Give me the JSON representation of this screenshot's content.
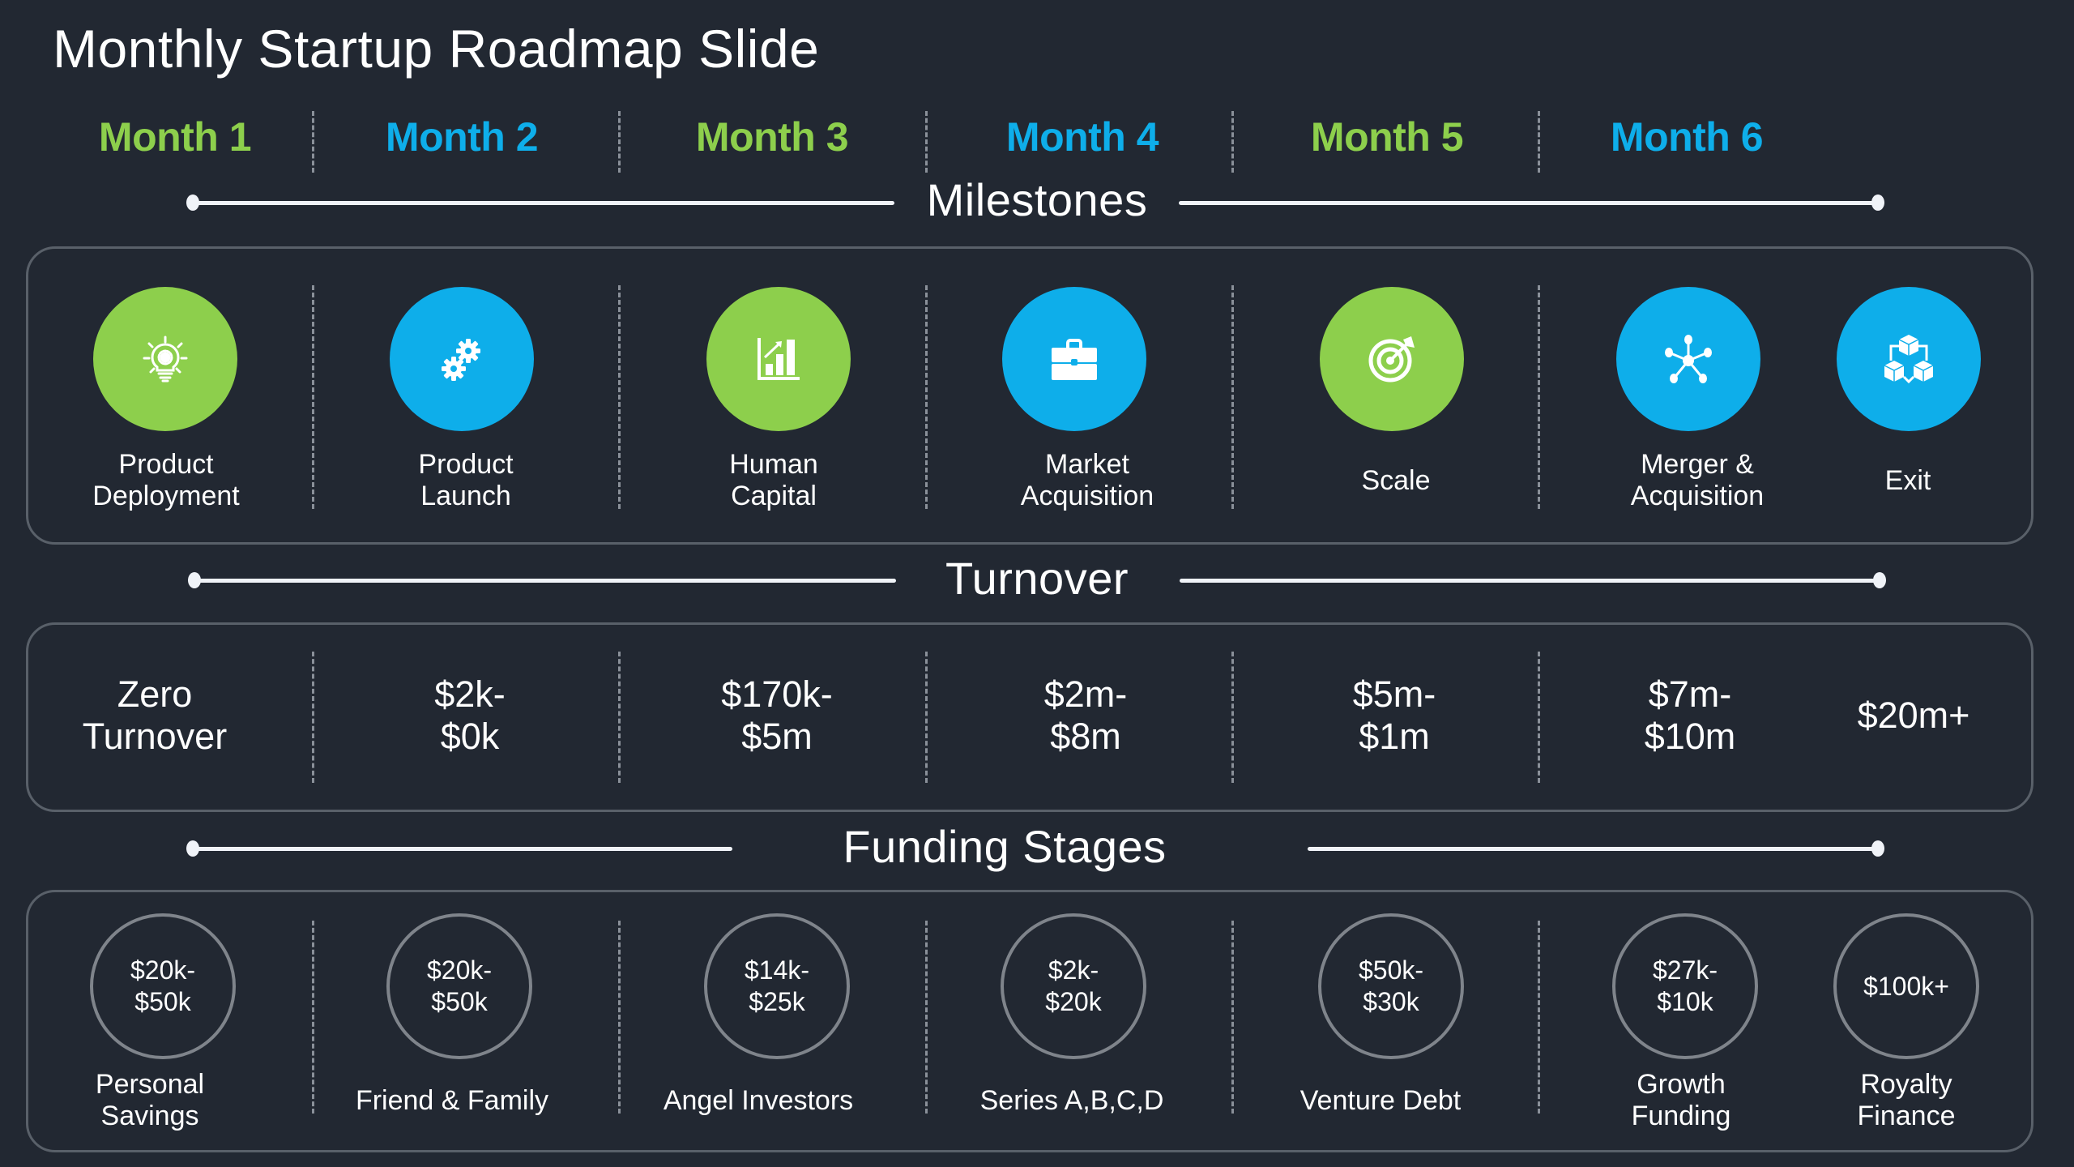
{
  "title": "Monthly Startup Roadmap Slide",
  "colors": {
    "background": "#222832",
    "green": "#8dcf4c",
    "blue": "#0eaeea",
    "panel_border": "#596069",
    "ring_border": "#7f848b"
  },
  "months": [
    {
      "label": "Month 1",
      "color": "green"
    },
    {
      "label": "Month 2",
      "color": "blue"
    },
    {
      "label": "Month 3",
      "color": "green"
    },
    {
      "label": "Month 4",
      "color": "blue"
    },
    {
      "label": "Month 5",
      "color": "green"
    },
    {
      "label": "Month 6",
      "color": "blue"
    }
  ],
  "sections": {
    "milestones": "Milestones",
    "turnover": "Turnover",
    "funding": "Funding Stages"
  },
  "milestones": [
    {
      "label_line1": "Product",
      "label_line2": "Deployment",
      "icon": "lightbulb-gear-icon",
      "color": "green"
    },
    {
      "label_line1": "Product",
      "label_line2": "Launch",
      "icon": "gears-icon",
      "color": "blue"
    },
    {
      "label_line1": "Human",
      "label_line2": "Capital",
      "icon": "bar-chart-growth-icon",
      "color": "green"
    },
    {
      "label_line1": "Market",
      "label_line2": "Acquisition",
      "icon": "briefcase-icon",
      "color": "blue"
    },
    {
      "label_line1": "Scale",
      "label_line2": "",
      "icon": "target-icon",
      "color": "green"
    },
    {
      "label_line1": "Merger &",
      "label_line2": "Acquisition",
      "icon": "network-icon",
      "color": "blue"
    },
    {
      "label_line1": "Exit",
      "label_line2": "",
      "icon": "blocks-icon",
      "color": "blue"
    }
  ],
  "turnover": [
    {
      "line1": "Zero",
      "line2": "Turnover"
    },
    {
      "line1": "$2k-",
      "line2": "$0k"
    },
    {
      "line1": "$170k-",
      "line2": "$5m"
    },
    {
      "line1": "$2m-",
      "line2": "$8m"
    },
    {
      "line1": "$5m-",
      "line2": "$1m"
    },
    {
      "line1": "$7m-",
      "line2": "$10m"
    },
    {
      "line1": "$20m+",
      "line2": ""
    }
  ],
  "funding": [
    {
      "amount_line1": "$20k-",
      "amount_line2": "$50k",
      "label_line1": "Personal",
      "label_line2": "Savings"
    },
    {
      "amount_line1": "$20k-",
      "amount_line2": "$50k",
      "label_line1": "Friend & Family",
      "label_line2": ""
    },
    {
      "amount_line1": "$14k-",
      "amount_line2": "$25k",
      "label_line1": "Angel Investors",
      "label_line2": ""
    },
    {
      "amount_line1": "$2k-",
      "amount_line2": "$20k",
      "label_line1": "Series A,B,C,D",
      "label_line2": ""
    },
    {
      "amount_line1": "$50k-",
      "amount_line2": "$30k",
      "label_line1": "Venture Debt",
      "label_line2": ""
    },
    {
      "amount_line1": "$27k-",
      "amount_line2": "$10k",
      "label_line1": "Growth",
      "label_line2": "Funding"
    },
    {
      "amount_line1": "$100k+",
      "amount_line2": "",
      "label_line1": "Royalty",
      "label_line2": "Finance"
    }
  ]
}
